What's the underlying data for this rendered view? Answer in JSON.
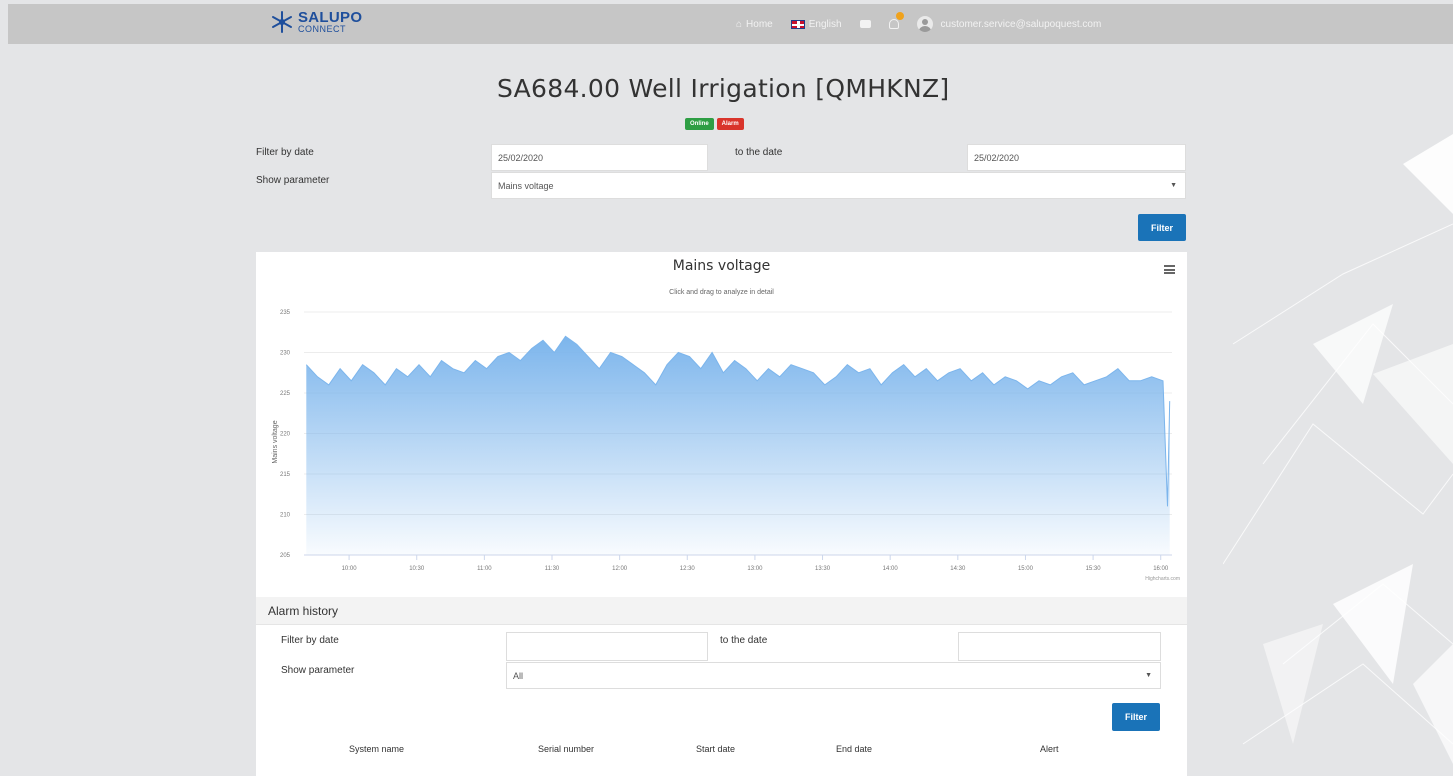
{
  "navbar": {
    "logo_main": "SALUPO",
    "logo_sub": "CONNECT",
    "home_label": "Home",
    "language_label": "English",
    "user_email": "customer.service@salupoquest.com"
  },
  "page": {
    "title": "SA684.00 Well Irrigation [QMHKNZ]",
    "badge_online": "Online",
    "badge_alarm": "Alarm"
  },
  "filters": {
    "filter_by_date_label": "Filter by date",
    "date_from": "25/02/2020",
    "to_the_date_label": "to the date",
    "date_to": "25/02/2020",
    "show_parameter_label": "Show parameter",
    "parameter_value": "Mains voltage",
    "filter_button": "Filter"
  },
  "chart": {
    "menu_icon": "hamburger-menu-icon",
    "credit": "Highcharts.com"
  },
  "chart_data": {
    "type": "area",
    "title": "Mains voltage",
    "subtitle": "Click and drag to analyze in detail",
    "ylabel": "Mains voltage",
    "xlabel": "",
    "ylim": [
      205,
      235
    ],
    "yticks": [
      205,
      210,
      215,
      220,
      225,
      230,
      235
    ],
    "xlim": [
      "09:40",
      "16:05"
    ],
    "xticks": [
      "10:00",
      "10:30",
      "11:00",
      "11:30",
      "12:00",
      "12:30",
      "13:00",
      "13:30",
      "14:00",
      "14:30",
      "15:00",
      "15:30",
      "16:00"
    ],
    "grid": true,
    "legend": false,
    "color": "#7cb5ec",
    "series": [
      {
        "x": [
          "09:41",
          "09:46",
          "09:51",
          "09:56",
          "10:01",
          "10:06",
          "10:11",
          "10:16",
          "10:21",
          "10:26",
          "10:31",
          "10:36",
          "10:41",
          "10:46",
          "10:51",
          "10:56",
          "11:01",
          "11:06",
          "11:11",
          "11:16",
          "11:21",
          "11:26",
          "11:31",
          "11:36",
          "11:41",
          "11:46",
          "11:51",
          "11:56",
          "12:01",
          "12:06",
          "12:11",
          "12:16",
          "12:21",
          "12:26",
          "12:31",
          "12:36",
          "12:41",
          "12:46",
          "12:51",
          "12:56",
          "13:01",
          "13:06",
          "13:11",
          "13:16",
          "13:21",
          "13:26",
          "13:31",
          "13:36",
          "13:41",
          "13:46",
          "13:51",
          "13:56",
          "14:01",
          "14:06",
          "14:11",
          "14:16",
          "14:21",
          "14:26",
          "14:31",
          "14:36",
          "14:41",
          "14:46",
          "14:51",
          "14:56",
          "15:01",
          "15:06",
          "15:11",
          "15:16",
          "15:21",
          "15:26",
          "15:31",
          "15:36",
          "15:41",
          "15:46",
          "15:51",
          "15:56",
          "16:01",
          "16:03",
          "16:04"
        ],
        "values": [
          228.5,
          227,
          226,
          228,
          226.5,
          228.5,
          227.5,
          226,
          228,
          227,
          228.5,
          227,
          229,
          228,
          227.5,
          229,
          228,
          229.5,
          230,
          229,
          230.5,
          231.5,
          230,
          232,
          231,
          229.5,
          228,
          230,
          229.5,
          228.5,
          227.5,
          226,
          228.5,
          230,
          229.5,
          228,
          230,
          227.5,
          229,
          228,
          226.5,
          228,
          227,
          228.5,
          228,
          227.5,
          226,
          227,
          228.5,
          227.5,
          228,
          226,
          227.5,
          228.5,
          227,
          228,
          226.5,
          227.5,
          228,
          226.5,
          227.5,
          226,
          227,
          226.5,
          225.5,
          226.5,
          226,
          227,
          227.5,
          226,
          226.5,
          227,
          228,
          226.5,
          226.5,
          227,
          226.5,
          211,
          224
        ]
      }
    ]
  },
  "alarm_history": {
    "title": "Alarm history",
    "filter_by_date_label": "Filter by date",
    "date_from": "",
    "to_the_date_label": "to the date",
    "date_to": "",
    "show_parameter_label": "Show parameter",
    "parameter_value": "All",
    "filter_button": "Filter",
    "columns": [
      "System name",
      "Serial number",
      "Start date",
      "End date",
      "Alert"
    ]
  }
}
